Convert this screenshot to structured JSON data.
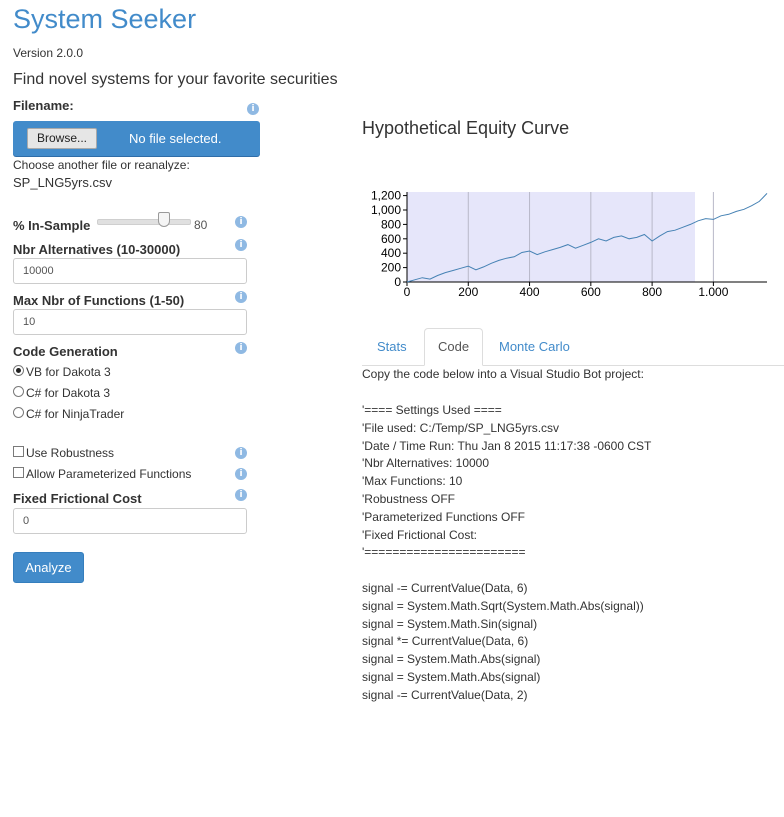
{
  "app": {
    "title": "System Seeker",
    "version": "Version 2.0.0",
    "tagline": "Find novel systems for your favorite securities"
  },
  "form": {
    "filename_label": "Filename:",
    "browse_label": "Browse...",
    "no_file_text": "No file selected.",
    "reanalyze_text": "Choose another file or reanalyze:",
    "current_file": "SP_LNG5yrs.csv",
    "insample_label": "% In-Sample",
    "insample_value": "80",
    "insample_fraction": 0.8,
    "alternatives_label": "Nbr Alternatives (10-30000)",
    "alternatives_value": "10000",
    "functions_label": "Max Nbr of Functions (1-50)",
    "functions_value": "10",
    "codegen_label": "Code Generation",
    "codegen_options": [
      {
        "label": "VB for Dakota 3",
        "checked": true
      },
      {
        "label": "C# for Dakota 3",
        "checked": false
      },
      {
        "label": "C# for NinjaTrader",
        "checked": false
      }
    ],
    "robustness_label": "Use Robustness",
    "robustness_checked": false,
    "parameterized_label": "Allow Parameterized Functions",
    "parameterized_checked": false,
    "frictional_label": "Fixed Frictional Cost",
    "frictional_value": "0",
    "analyze_label": "Analyze",
    "info_icon_glyph": "i"
  },
  "chart": {
    "title": "Hypothetical Equity Curve"
  },
  "chart_data": {
    "type": "line",
    "title": "Hypothetical Equity Curve",
    "xlabel": "",
    "ylabel": "",
    "xlim": [
      0,
      1175
    ],
    "ylim": [
      0,
      1250
    ],
    "x_ticks": [
      0,
      200,
      400,
      600,
      800,
      1000
    ],
    "x_tick_labels": [
      "0",
      "200",
      "400",
      "600",
      "800",
      "1,000"
    ],
    "y_ticks": [
      0,
      200,
      400,
      600,
      800,
      1000,
      1200
    ],
    "y_tick_labels": [
      "0",
      "200",
      "400",
      "600",
      "800",
      "1,000",
      "1,200"
    ],
    "in_sample_range": [
      0,
      940
    ],
    "grid": "vertical",
    "line_color": "#4682b4",
    "shade_color": "#e6e6fa",
    "series": [
      {
        "x": [
          0,
          25,
          50,
          75,
          100,
          125,
          150,
          175,
          200,
          225,
          250,
          275,
          300,
          325,
          350,
          375,
          400,
          425,
          450,
          475,
          500,
          525,
          550,
          575,
          600,
          625,
          650,
          675,
          700,
          725,
          750,
          775,
          800,
          825,
          850,
          875,
          900,
          925,
          950,
          975,
          1000,
          1025,
          1050,
          1075,
          1100,
          1125,
          1150,
          1175
        ],
        "y": [
          0,
          30,
          60,
          40,
          90,
          130,
          160,
          190,
          220,
          170,
          210,
          260,
          300,
          330,
          350,
          410,
          430,
          380,
          420,
          450,
          480,
          520,
          470,
          510,
          550,
          600,
          570,
          620,
          640,
          600,
          620,
          660,
          570,
          640,
          700,
          720,
          760,
          800,
          850,
          880,
          870,
          920,
          940,
          980,
          1010,
          1060,
          1120,
          1230
        ]
      }
    ]
  },
  "tabs": [
    {
      "label": "Stats",
      "active": false
    },
    {
      "label": "Code",
      "active": true
    },
    {
      "label": "Monte Carlo",
      "active": false
    }
  ],
  "code": {
    "intro": "Copy the code below into a Visual Studio Bot project:",
    "lines": [
      "'==== Settings Used ====",
      "'File used: C:/Temp/SP_LNG5yrs.csv",
      "'Date / Time Run: Thu Jan 8 2015 11:17:38 -0600 CST",
      "'Nbr Alternatives: 10000",
      "'Max Functions: 10",
      "'Robustness OFF",
      "'Parameterized Functions OFF",
      "'Fixed Frictional Cost:",
      "'=======================",
      "",
      "signal -= CurrentValue(Data, 6)",
      "signal = System.Math.Sqrt(System.Math.Abs(signal))",
      "signal = System.Math.Sin(signal)",
      "signal *= CurrentValue(Data, 6)",
      "signal = System.Math.Abs(signal)",
      "signal = System.Math.Abs(signal)",
      "signal -= CurrentValue(Data, 2)"
    ]
  }
}
